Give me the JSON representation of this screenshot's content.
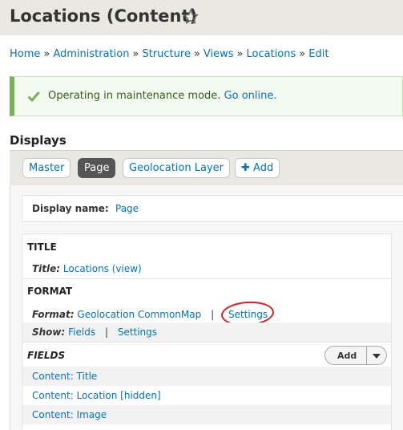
{
  "page": {
    "title": "Locations (Content)"
  },
  "breadcrumb": {
    "items": [
      "Home",
      "Administration",
      "Structure",
      "Views",
      "Locations",
      "Edit"
    ],
    "separator": "»"
  },
  "message": {
    "text": "Operating in maintenance mode.",
    "link": "Go online."
  },
  "displays": {
    "heading": "Displays",
    "tabs": [
      "Master",
      "Page",
      "Geolocation Layer",
      "Add"
    ],
    "add_symbol": "✚",
    "active_tab": "Page"
  },
  "display_name": {
    "label": "Display name:",
    "value": "Page"
  },
  "title_section": {
    "heading": "TITLE",
    "label": "Title:",
    "value": "Locations (view)"
  },
  "format_section": {
    "heading": "FORMAT",
    "format_label": "Format:",
    "format_value": "Geolocation CommonMap",
    "pipe": "|",
    "settings_link": "Settings",
    "show_label": "Show:",
    "show_value": "Fields",
    "show_settings": "Settings"
  },
  "fields_section": {
    "heading": "FIELDS",
    "add_button": "Add",
    "items": [
      "Content: Title",
      "Content: Location [hidden]",
      "Content: Image"
    ]
  },
  "colors": {
    "link": "#0074bd",
    "success": "#77b259",
    "annotation": "#d62020"
  }
}
